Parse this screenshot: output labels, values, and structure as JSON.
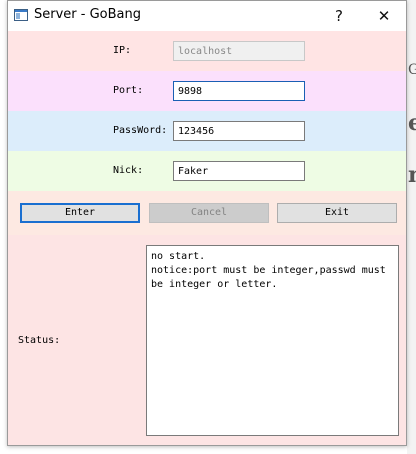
{
  "window": {
    "title": "Server - GoBang",
    "help_symbol": "?",
    "close_symbol": "✕"
  },
  "form": {
    "ip": {
      "label": "IP:",
      "value": "localhost",
      "enabled": false
    },
    "port": {
      "label": "Port:",
      "value": "9898"
    },
    "password": {
      "label": "PassWord:",
      "value": "123456"
    },
    "nick": {
      "label": "Nick:",
      "value": "Faker"
    }
  },
  "buttons": {
    "enter": "Enter",
    "cancel": "Cancel",
    "exit": "Exit"
  },
  "status": {
    "label": "Status:",
    "text": "no start.\nnotice:port must be integer,passwd must be integer or letter."
  },
  "colors": {
    "ip_row": "#ffe4e4",
    "port_row": "#fbe0fc",
    "password_row": "#dcedfb",
    "nick_row": "#eefce4",
    "buttons_row": "#fde9e2",
    "status_row": "#fde4e4",
    "accent": "#1a6fd0"
  },
  "background_fragments": [
    "G",
    "e",
    "m"
  ]
}
